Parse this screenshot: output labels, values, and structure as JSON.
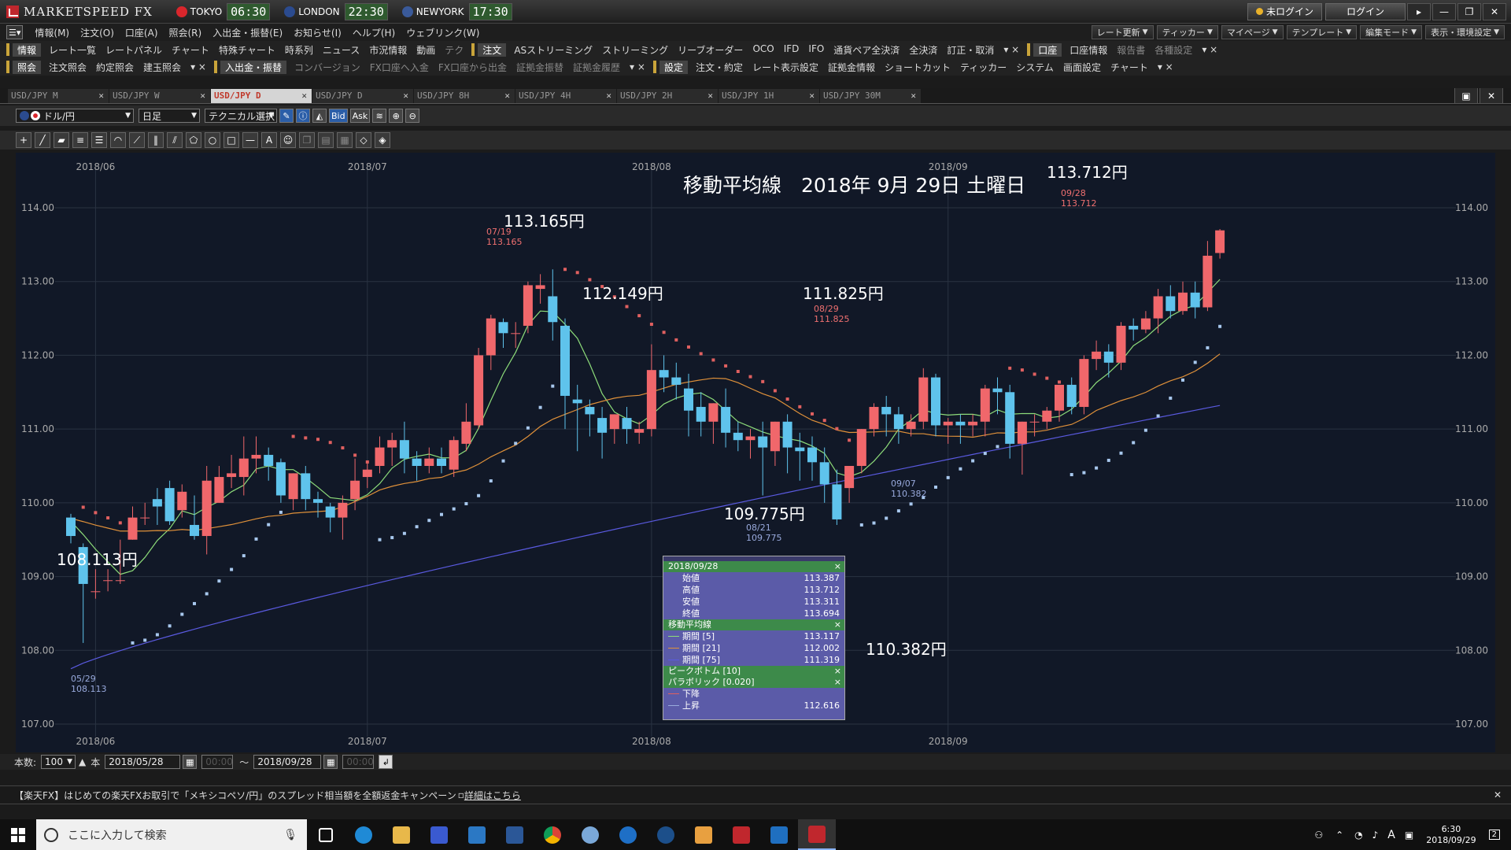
{
  "app": {
    "title": "MARKETSPEED FX"
  },
  "clocks": [
    {
      "city": "TOKYO",
      "time": "06:30",
      "color": "#d9262c"
    },
    {
      "city": "LONDON",
      "time": "22:30",
      "color": "#2b4b8f"
    },
    {
      "city": "NEWYORK",
      "time": "17:30",
      "color": "#3a5a9a"
    }
  ],
  "title_buttons": {
    "login_status": "未ログイン",
    "login": "ログイン"
  },
  "menu": [
    "情報(M)",
    "注文(O)",
    "口座(A)",
    "照会(R)",
    "入出金・振替(E)",
    "お知らせ(I)",
    "ヘルプ(H)",
    "ウェブリンク(W)"
  ],
  "menu_right": [
    "レート更新",
    "ティッカー",
    "マイページ",
    "テンプレート",
    "編集モード",
    "表示・環境設定"
  ],
  "toolbar1": {
    "info_group": "情報",
    "info_items": [
      "レート一覧",
      "レートパネル",
      "チャート",
      "特殊チャート",
      "時系列",
      "ニュース",
      "市況情報",
      "動画",
      "テク"
    ],
    "order_group": "注文",
    "order_items": [
      "ASストリーミング",
      "ストリーミング",
      "リーブオーダー",
      "OCO",
      "IFD",
      "IFO",
      "通貨ペア全決済",
      "全決済",
      "訂正・取消"
    ],
    "account_group": "口座",
    "account_items": [
      "口座情報",
      "報告書",
      "各種設定"
    ]
  },
  "toolbar2": {
    "inquiry_group": "照会",
    "inquiry_items": [
      "注文照会",
      "約定照会",
      "建玉照会"
    ],
    "deposit_group": "入出金・振替",
    "deposit_items": [
      "コンバージョン",
      "FX口座へ入金",
      "FX口座から出金",
      "証拠金振替",
      "証拠金履歴"
    ],
    "settings_group": "設定",
    "settings_items": [
      "注文・約定",
      "レート表示設定",
      "証拠金情報",
      "ショートカット",
      "ティッカー",
      "システム",
      "画面設定",
      "チャート"
    ]
  },
  "tabs": [
    "USD/JPY M",
    "USD/JPY W",
    "USD/JPY D",
    "USD/JPY D",
    "USD/JPY 8H",
    "USD/JPY 4H",
    "USD/JPY 2H",
    "USD/JPY 1H",
    "USD/JPY 30M"
  ],
  "active_tab_index": 2,
  "chart_controls": {
    "pair": "ドル/円",
    "period": "日足",
    "technical": "テクニカル選択",
    "bid": "Bid",
    "ask": "Ask"
  },
  "chart_data": {
    "type": "candlestick",
    "title": "移動平均線　2018年 9月 29日 土曜日",
    "y_ticks": [
      "114.00",
      "113.00",
      "112.00",
      "111.00",
      "110.00",
      "109.00",
      "108.00",
      "107.00"
    ],
    "ylim": [
      107.0,
      114.0
    ],
    "x_labels": [
      "2018/06",
      "2018/07",
      "2018/08",
      "2018/09"
    ],
    "x_label_index": [
      2,
      24,
      47,
      71
    ],
    "candles": [
      [
        109.8,
        109.85,
        109.55,
        109.45
      ],
      [
        109.4,
        109.45,
        108.9,
        108.1
      ],
      [
        108.8,
        109.1,
        108.8,
        108.7
      ],
      [
        108.95,
        109.1,
        108.95,
        108.8
      ],
      [
        108.95,
        109.5,
        108.95,
        108.9
      ],
      [
        109.5,
        109.95,
        109.8,
        109.5
      ],
      [
        109.8,
        110.0,
        109.8,
        109.7
      ],
      [
        110.05,
        110.2,
        109.95,
        109.7
      ],
      [
        110.2,
        110.3,
        109.75,
        109.7
      ],
      [
        109.9,
        110.25,
        110.15,
        109.8
      ],
      [
        109.7,
        110.1,
        109.55,
        109.5
      ],
      [
        109.55,
        110.5,
        110.3,
        109.3
      ],
      [
        110.0,
        110.5,
        110.35,
        110.0
      ],
      [
        110.35,
        110.65,
        110.4,
        110.2
      ],
      [
        110.35,
        110.9,
        110.6,
        110.1
      ],
      [
        110.6,
        110.9,
        110.65,
        110.4
      ],
      [
        110.65,
        110.75,
        110.5,
        110.3
      ],
      [
        110.55,
        110.6,
        110.1,
        110.0
      ],
      [
        110.05,
        110.4,
        110.4,
        109.9
      ],
      [
        110.4,
        110.5,
        110.05,
        109.9
      ],
      [
        110.05,
        110.15,
        110.0,
        109.8
      ],
      [
        109.95,
        110.0,
        109.8,
        109.6
      ],
      [
        109.8,
        110.1,
        110.0,
        109.5
      ],
      [
        110.05,
        110.6,
        110.3,
        109.9
      ],
      [
        110.35,
        110.55,
        110.45,
        110.2
      ],
      [
        110.5,
        110.9,
        110.75,
        110.4
      ],
      [
        110.75,
        110.95,
        110.85,
        110.5
      ],
      [
        110.85,
        111.1,
        110.6,
        110.4
      ],
      [
        110.6,
        110.7,
        110.5,
        110.3
      ],
      [
        110.5,
        110.75,
        110.6,
        110.4
      ],
      [
        110.6,
        110.75,
        110.5,
        110.4
      ],
      [
        110.45,
        110.9,
        110.85,
        110.35
      ],
      [
        110.8,
        111.35,
        111.1,
        110.7
      ],
      [
        111.05,
        112.1,
        112.0,
        111.0
      ],
      [
        112.0,
        112.55,
        112.5,
        111.8
      ],
      [
        112.45,
        112.5,
        112.3,
        112.1
      ],
      [
        112.3,
        112.45,
        112.3,
        112.1
      ],
      [
        112.4,
        113.0,
        112.95,
        112.3
      ],
      [
        112.9,
        113.1,
        112.95,
        112.7
      ],
      [
        112.8,
        113.165,
        112.45,
        112.2
      ],
      [
        112.4,
        112.5,
        111.45,
        111.0
      ],
      [
        111.4,
        111.6,
        111.35,
        110.7
      ],
      [
        111.3,
        111.4,
        111.2,
        110.9
      ],
      [
        111.15,
        111.3,
        110.95,
        110.6
      ],
      [
        111.0,
        111.2,
        111.2,
        110.8
      ],
      [
        111.15,
        111.3,
        111.0,
        110.8
      ],
      [
        110.95,
        111.1,
        111.0,
        110.8
      ],
      [
        111.0,
        112.149,
        111.8,
        110.9
      ],
      [
        111.8,
        112.0,
        111.7,
        111.5
      ],
      [
        111.7,
        111.9,
        111.6,
        111.4
      ],
      [
        111.55,
        111.75,
        111.25,
        110.9
      ],
      [
        111.3,
        111.5,
        111.1,
        110.9
      ],
      [
        111.1,
        111.35,
        111.35,
        110.8
      ],
      [
        111.3,
        111.55,
        110.95,
        110.75
      ],
      [
        110.95,
        111.1,
        110.85,
        110.7
      ],
      [
        110.85,
        111.0,
        110.9,
        110.6
      ],
      [
        110.9,
        111.1,
        110.75,
        110.1
      ],
      [
        110.7,
        111.1,
        111.1,
        110.5
      ],
      [
        111.1,
        111.2,
        110.75,
        110.4
      ],
      [
        110.75,
        110.95,
        110.7,
        110.3
      ],
      [
        110.75,
        110.9,
        110.55,
        110.3
      ],
      [
        110.55,
        110.75,
        110.25,
        110.0
      ],
      [
        110.25,
        110.45,
        109.775,
        109.7
      ],
      [
        110.2,
        110.3,
        110.5,
        110.0
      ],
      [
        110.5,
        111.0,
        111.0,
        110.4
      ],
      [
        111.0,
        111.35,
        111.3,
        110.9
      ],
      [
        111.3,
        111.45,
        111.2,
        110.9
      ],
      [
        111.2,
        111.3,
        111.0,
        110.8
      ],
      [
        111.0,
        111.2,
        111.1,
        110.9
      ],
      [
        111.1,
        111.825,
        111.7,
        111.0
      ],
      [
        111.7,
        111.75,
        111.05,
        110.9
      ],
      [
        111.05,
        111.15,
        111.1,
        110.8
      ],
      [
        111.1,
        111.2,
        111.05,
        110.8
      ],
      [
        111.05,
        111.2,
        111.1,
        110.9
      ],
      [
        111.1,
        111.6,
        111.55,
        110.9
      ],
      [
        111.55,
        111.7,
        111.5,
        111.2
      ],
      [
        111.5,
        111.6,
        110.8,
        110.6
      ],
      [
        110.8,
        111.1,
        111.1,
        110.382
      ],
      [
        111.1,
        111.2,
        111.1,
        110.9
      ],
      [
        111.1,
        111.3,
        111.25,
        111.0
      ],
      [
        111.25,
        111.6,
        111.6,
        111.1
      ],
      [
        111.6,
        111.7,
        111.3,
        111.2
      ],
      [
        111.3,
        112.0,
        111.95,
        111.2
      ],
      [
        111.95,
        112.2,
        112.05,
        111.8
      ],
      [
        112.05,
        112.15,
        111.9,
        111.7
      ],
      [
        111.9,
        112.45,
        112.4,
        111.8
      ],
      [
        112.4,
        112.5,
        112.35,
        112.2
      ],
      [
        112.35,
        112.6,
        112.5,
        112.3
      ],
      [
        112.5,
        112.9,
        112.8,
        112.3
      ],
      [
        112.8,
        112.95,
        112.6,
        112.5
      ],
      [
        112.6,
        113.0,
        112.85,
        112.55
      ],
      [
        112.85,
        113.0,
        112.65,
        112.5
      ],
      [
        112.65,
        113.55,
        113.35,
        112.6
      ],
      [
        113.387,
        113.712,
        113.694,
        113.311
      ]
    ],
    "ma": [
      {
        "name": "期間 [5]",
        "color": "#8ddc7a",
        "last": "113.117"
      },
      {
        "name": "期間 [21]",
        "color": "#e0913a",
        "last": "112.002"
      },
      {
        "name": "期間 [75]",
        "color": "#5a5ae0",
        "last": "111.319"
      }
    ],
    "psar": {
      "name": "パラボリック [0.020]"
    },
    "peak_bottom": {
      "name": "ピークボトム [10]"
    },
    "annotations": [
      {
        "label": "108.113円",
        "date": "05/29",
        "value": "108.113"
      },
      {
        "label": "113.165円",
        "date": "07/19",
        "value": "113.165"
      },
      {
        "label": "112.149円",
        "date": "",
        "value": ""
      },
      {
        "label": "109.775円",
        "date": "08/21",
        "value": "109.775"
      },
      {
        "label": "111.825円",
        "date": "08/29",
        "value": "111.825"
      },
      {
        "label": "110.382円",
        "date": "09/07",
        "value": "110.382"
      },
      {
        "label": "113.712円",
        "date": "09/28",
        "value": "113.712"
      }
    ]
  },
  "info_panel": {
    "date": "2018/09/28",
    "ohlc": [
      {
        "label": "始値",
        "value": "113.387"
      },
      {
        "label": "高値",
        "value": "113.712"
      },
      {
        "label": "安値",
        "value": "113.311"
      },
      {
        "label": "終値",
        "value": "113.694"
      }
    ],
    "ma_header": "移動平均線",
    "pb_header": "ピークボトム [10]",
    "psar_header": "パラボリック [0.020]",
    "down_label": "下降",
    "up_label": "上昇",
    "up_value": "112.616"
  },
  "bottom": {
    "count_label": "本数:",
    "count": "100",
    "unit": "本",
    "from": "2018/05/28",
    "to": "2018/09/28",
    "tilde": "～",
    "time_placeholder": "00:00"
  },
  "ticker": {
    "text": "【楽天FX】はじめての楽天FXお取引で「メキシコペソ/円」のスプレッド相当額を全額返金キャンペーン",
    "link": "詳細はこちら"
  },
  "taskbar": {
    "search_placeholder": "ここに入力して検索",
    "time": "6:30",
    "date": "2018/09/29",
    "ime": "A",
    "notif": "2"
  }
}
